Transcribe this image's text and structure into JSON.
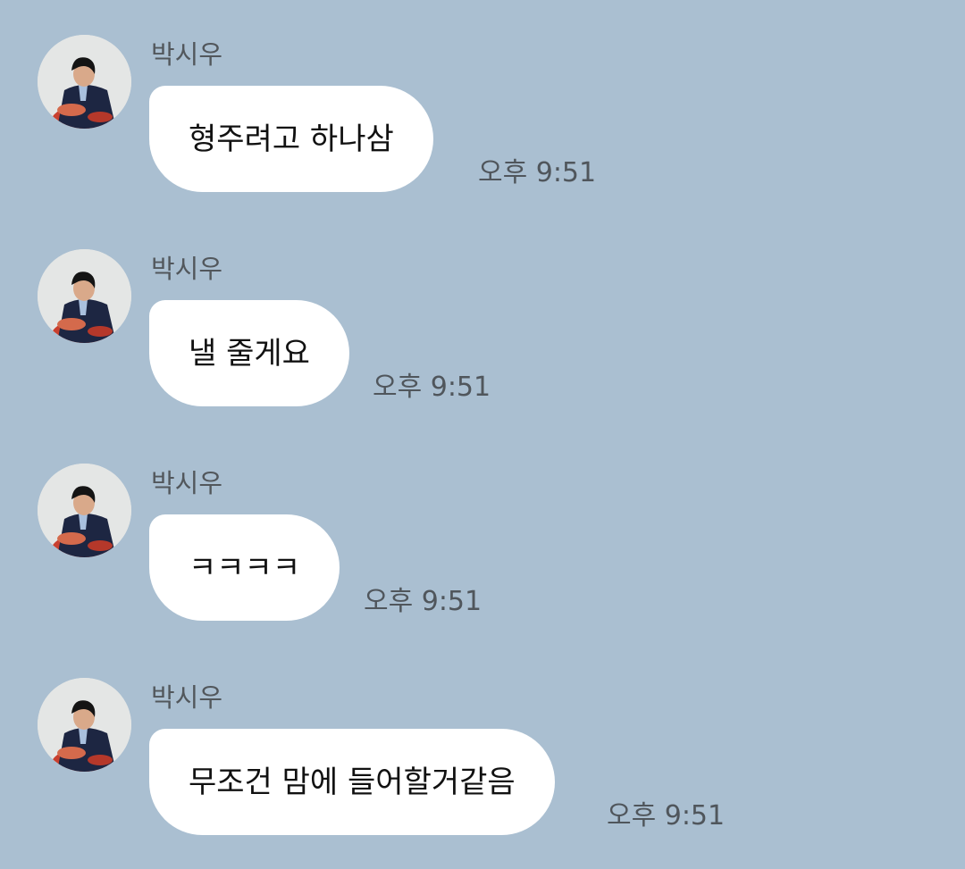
{
  "colors": {
    "background": "#aabfd1",
    "bubble": "#ffffff",
    "sender_text": "#52575c",
    "time_text": "#50565c",
    "message_text": "#111111"
  },
  "messages": [
    {
      "sender": "박시우",
      "text": "형주려고 하나삼",
      "time": "오후 9:51",
      "avatar": "profile-photo"
    },
    {
      "sender": "박시우",
      "text": "낼 줄게요",
      "time": "오후 9:51",
      "avatar": "profile-photo"
    },
    {
      "sender": "박시우",
      "text": "ㅋㅋㅋㅋ",
      "time": "오후 9:51",
      "avatar": "profile-photo"
    },
    {
      "sender": "박시우",
      "text": "무조건 맘에 들어할거같음",
      "time": "오후 9:51",
      "avatar": "profile-photo"
    }
  ]
}
